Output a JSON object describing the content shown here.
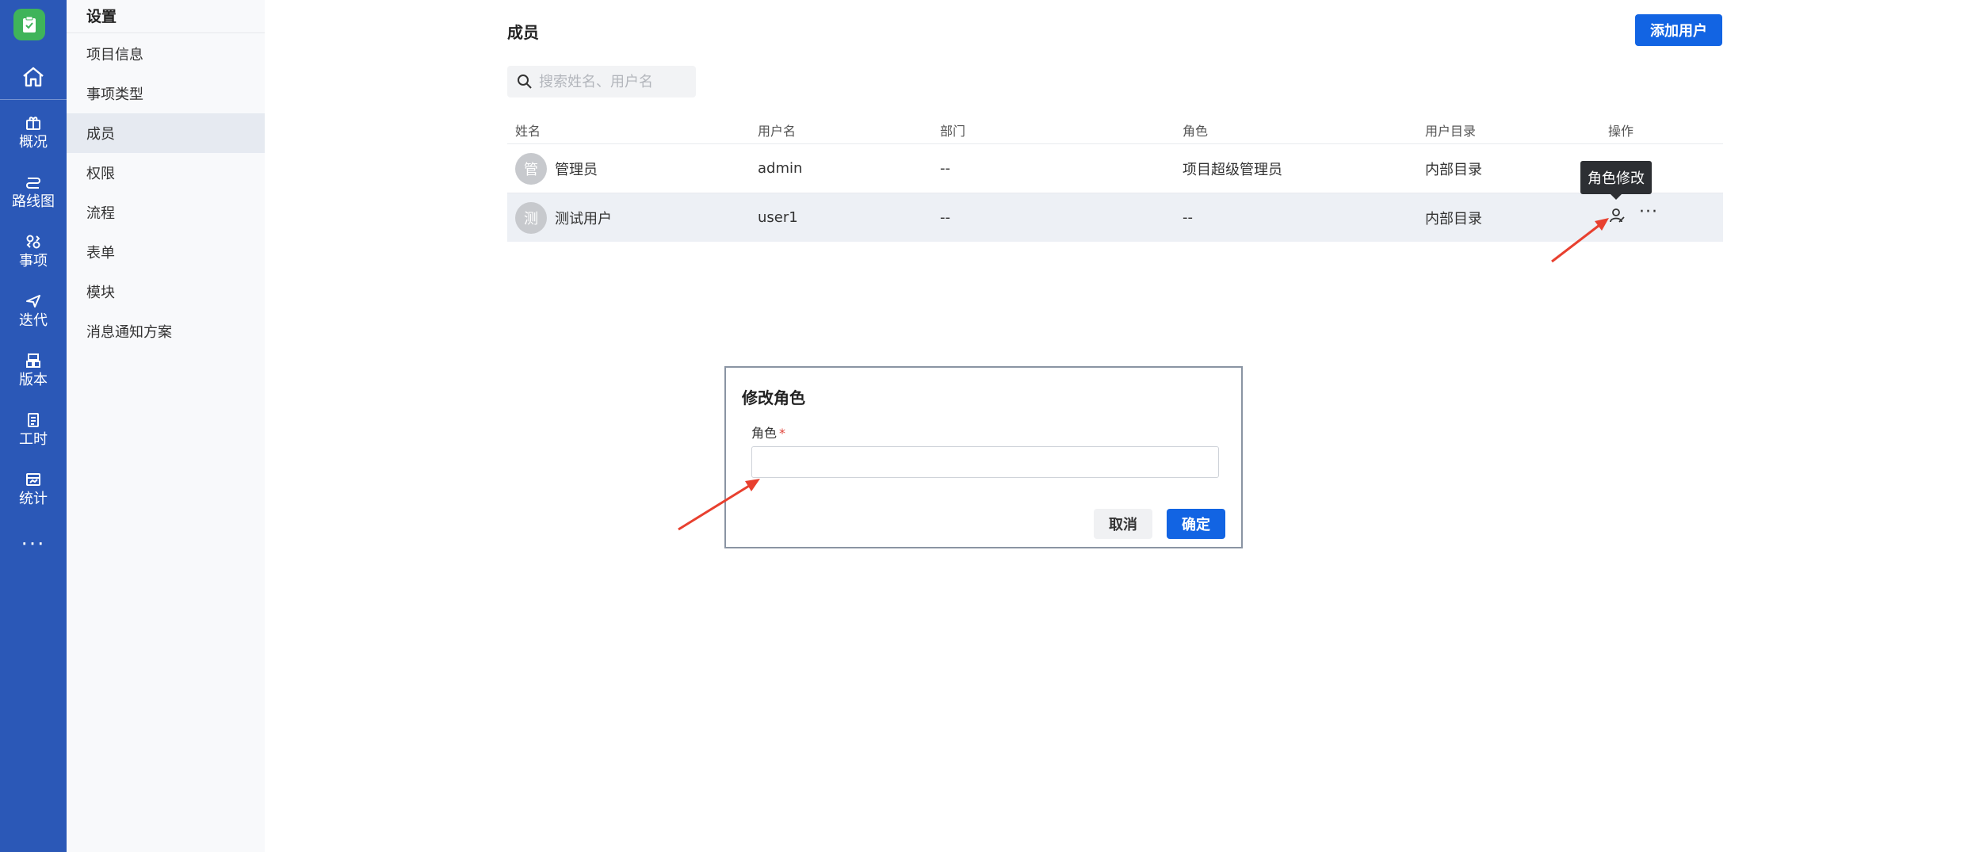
{
  "rail": {
    "items": [
      {
        "label": "概况",
        "icon": "overview-icon"
      },
      {
        "label": "路线图",
        "icon": "roadmap-icon"
      },
      {
        "label": "事项",
        "icon": "issue-icon"
      },
      {
        "label": "迭代",
        "icon": "sprint-icon"
      },
      {
        "label": "版本",
        "icon": "version-icon"
      },
      {
        "label": "工时",
        "icon": "worklog-icon"
      },
      {
        "label": "统计",
        "icon": "statistics-icon"
      }
    ],
    "more": "···",
    "accent": "#2b58b7",
    "logo_color": "#3fb45a"
  },
  "sidebar": {
    "title": "设置",
    "items": [
      {
        "label": "项目信息"
      },
      {
        "label": "事项类型"
      },
      {
        "label": "成员"
      },
      {
        "label": "权限"
      },
      {
        "label": "流程"
      },
      {
        "label": "表单"
      },
      {
        "label": "模块"
      },
      {
        "label": "消息通知方案"
      }
    ],
    "active_index": 2
  },
  "main": {
    "title": "成员",
    "add_button": "添加用户",
    "search_placeholder": "搜索姓名、用户名",
    "columns": [
      "姓名",
      "用户名",
      "部门",
      "角色",
      "用户目录",
      "操作"
    ],
    "rows": [
      {
        "avatar": "管",
        "name": "管理员",
        "username": "admin",
        "dept": "--",
        "role": "项目超级管理员",
        "directory": "内部目录"
      },
      {
        "avatar": "测",
        "name": "测试用户",
        "username": "user1",
        "dept": "--",
        "role": "--",
        "directory": "内部目录"
      }
    ],
    "tooltip": "角色修改",
    "more_actions": "···"
  },
  "dialog": {
    "title": "修改角色",
    "field_label": "角色",
    "required_mark": "*",
    "field_value": "",
    "cancel": "取消",
    "ok": "确定"
  },
  "colors": {
    "primary": "#1264e3",
    "annotation_arrow": "#e8402f"
  }
}
